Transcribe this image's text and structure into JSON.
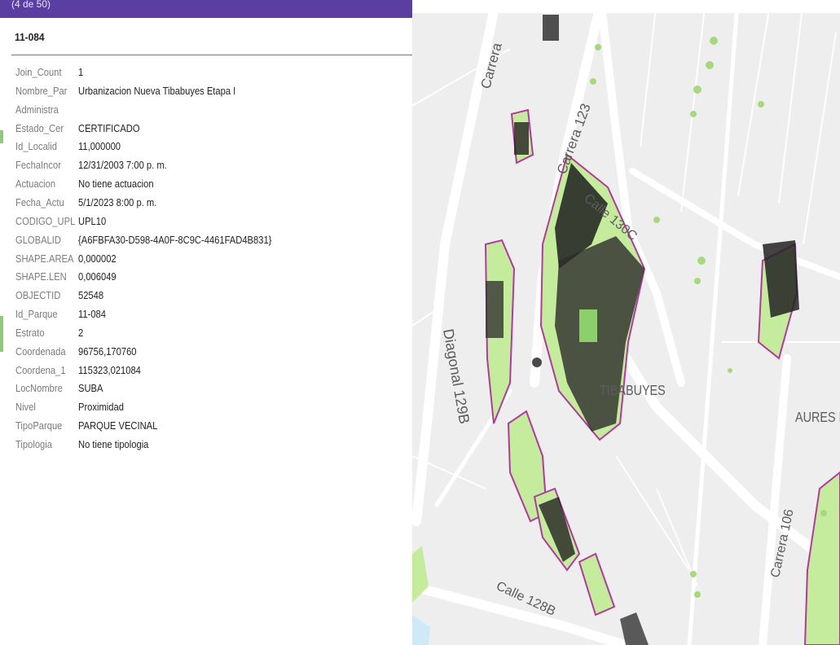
{
  "popup": {
    "counter": "(4 de 50)",
    "title": "11-084",
    "fields": [
      {
        "key": "Join_Count",
        "value": "1"
      },
      {
        "key": "Nombre_Par",
        "value": "Urbanizacion Nueva Tibabuyes Etapa I"
      },
      {
        "key": "Administra",
        "value": ""
      },
      {
        "key": "Estado_Cer",
        "value": "CERTIFICADO"
      },
      {
        "key": "Id_Localid",
        "value": "11,000000"
      },
      {
        "key": "FechaIncor",
        "value": "12/31/2003 7:00 p. m."
      },
      {
        "key": "Actuacion",
        "value": "No tiene actuacion"
      },
      {
        "key": "Fecha_Actu",
        "value": "5/1/2023 8:00 p. m."
      },
      {
        "key": "CODIGO_UPL",
        "value": "UPL10"
      },
      {
        "key": "GLOBALID",
        "value": "{A6FBFA30-D598-4A0F-8C9C-4461FAD4B831}"
      },
      {
        "key": "SHAPE.AREA",
        "value": "0,000002"
      },
      {
        "key": "SHAPE.LEN",
        "value": "0,006049"
      },
      {
        "key": "OBJECTID",
        "value": "52548"
      },
      {
        "key": "Id_Parque",
        "value": "11-084"
      },
      {
        "key": "Estrato",
        "value": "2"
      },
      {
        "key": "Coordenada",
        "value": "96756,170760"
      },
      {
        "key": "Coordena_1",
        "value": "115323,021084"
      },
      {
        "key": "LocNombre",
        "value": "SUBA"
      },
      {
        "key": "Nivel",
        "value": "Proximidad"
      },
      {
        "key": "TipoParque",
        "value": "PARQUE VECINAL"
      },
      {
        "key": "Tipologia",
        "value": "No tiene tipologia"
      }
    ]
  },
  "map": {
    "labels": {
      "carrera_top": "Carrera",
      "carrera_123": "Carrera 123",
      "calle_130c": "Calle 130C",
      "diagonal_129b": "Diagonal 129B",
      "tibabuyes": "TIBABUYES",
      "aures": "AURES II",
      "carrera_106": "Carrera 106",
      "calle_128b": "Calle 128B"
    },
    "colors": {
      "base": "#eeeeee",
      "road": "#ffffff",
      "park": "#c5ec9c",
      "park_outline": "#b03a9e",
      "header": "#5a3ea1"
    }
  }
}
